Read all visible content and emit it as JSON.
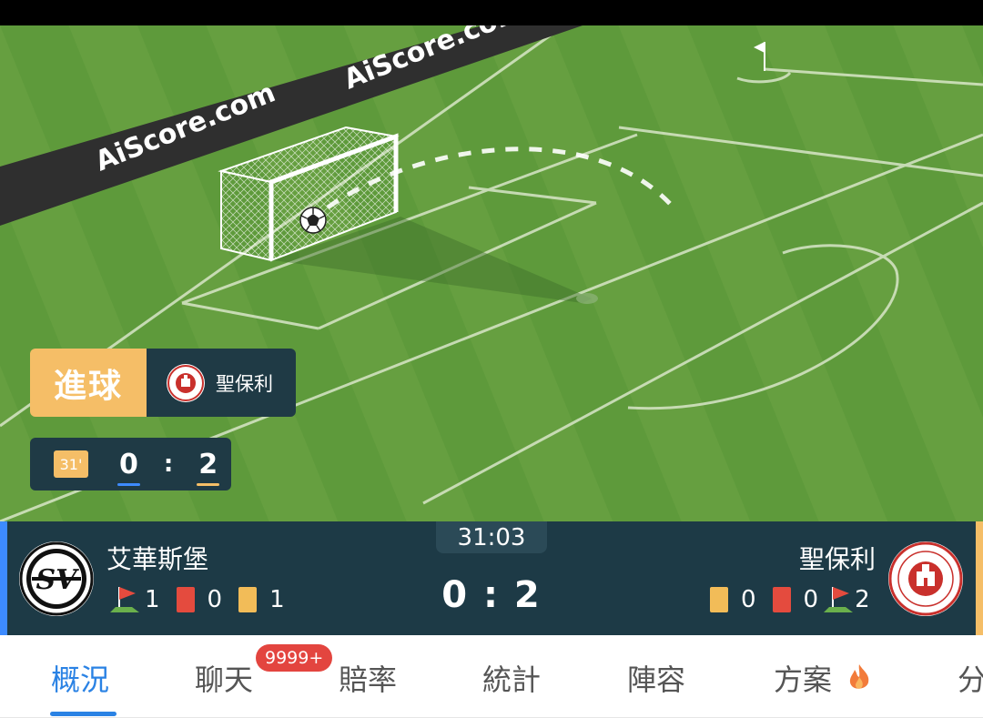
{
  "pitch": {
    "watermark": "AiScore.com"
  },
  "event": {
    "type": "進球",
    "team": "聖保利",
    "minute": "31'",
    "home_score": "0",
    "away_score": "2",
    "separator": ":"
  },
  "match": {
    "clock": "31:03",
    "score": "0 : 2",
    "home": {
      "name": "艾華斯堡",
      "corners": "1",
      "red_cards": "0",
      "yellow_cards": "1"
    },
    "away": {
      "name": "聖保利",
      "yellow_cards": "0",
      "red_cards": "0",
      "corners": "2"
    }
  },
  "tabs": {
    "items": [
      "概況",
      "聊天",
      "賠率",
      "統計",
      "陣容",
      "方案",
      "分"
    ],
    "active": "概況",
    "chat_badge": "9999+"
  },
  "colors": {
    "accent_blue": "#2a82e4",
    "home_blue": "#3d8bff",
    "away_yellow": "#f5be67",
    "panel_dark": "#1d3a46",
    "red_card": "#e44b3e",
    "pitch_green": "#5f9b3c"
  }
}
